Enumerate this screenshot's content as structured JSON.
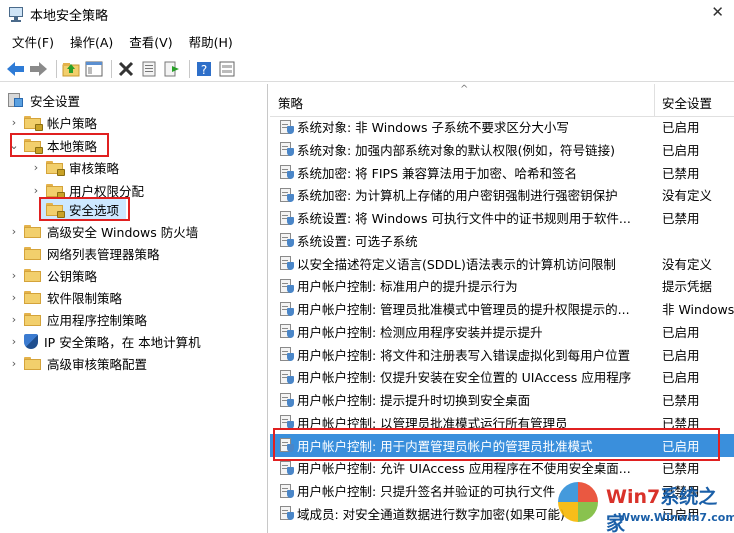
{
  "window": {
    "title": "本地安全策略",
    "close_glyph": "✕"
  },
  "menu": [
    "文件(F)",
    "操作(A)",
    "查看(V)",
    "帮助(H)"
  ],
  "toolbar_icons": [
    "back-arrow-icon",
    "forward-arrow-icon",
    "up-folder-icon",
    "show-hide-tree-icon",
    "delete-icon",
    "properties-icon",
    "export-list-icon",
    "help-icon",
    "console-view-icon"
  ],
  "tree": {
    "root": "安全设置",
    "items": [
      {
        "label": "帐户策略",
        "level": 1,
        "expander": "›"
      },
      {
        "label": "本地策略",
        "level": 1,
        "expander": "⌄"
      },
      {
        "label": "审核策略",
        "level": 2,
        "expander": "›"
      },
      {
        "label": "用户权限分配",
        "level": 2,
        "expander": "›"
      },
      {
        "label": "安全选项",
        "level": 2,
        "expander": ""
      },
      {
        "label": "高级安全 Windows 防火墙",
        "level": 1,
        "expander": "›"
      },
      {
        "label": "网络列表管理器策略",
        "level": 1,
        "expander": ""
      },
      {
        "label": "公钥策略",
        "level": 1,
        "expander": "›"
      },
      {
        "label": "软件限制策略",
        "level": 1,
        "expander": "›"
      },
      {
        "label": "应用程序控制策略",
        "level": 1,
        "expander": "›"
      },
      {
        "label": "IP 安全策略，在 本地计算机",
        "level": 1,
        "expander": "›"
      },
      {
        "label": "高级审核策略配置",
        "level": 1,
        "expander": "›"
      }
    ]
  },
  "list": {
    "columns": {
      "policy": "策略",
      "setting": "安全设置",
      "sort_glyph": "^"
    },
    "rows": [
      {
        "policy": "系统对象: 非 Windows 子系统不要求区分大小写",
        "setting": "已启用"
      },
      {
        "policy": "系统对象: 加强内部系统对象的默认权限(例如，符号链接)",
        "setting": "已启用"
      },
      {
        "policy": "系统加密: 将 FIPS 兼容算法用于加密、哈希和签名",
        "setting": "已禁用"
      },
      {
        "policy": "系统加密: 为计算机上存储的用户密钥强制进行强密钥保护",
        "setting": "没有定义"
      },
      {
        "policy": "系统设置: 将 Windows 可执行文件中的证书规则用于软件...",
        "setting": "已禁用"
      },
      {
        "policy": "系统设置: 可选子系统",
        "setting": ""
      },
      {
        "policy": "以安全描述符定义语言(SDDL)语法表示的计算机访问限制",
        "setting": "没有定义"
      },
      {
        "policy": "用户帐户控制: 标准用户的提升提示行为",
        "setting": "提示凭据"
      },
      {
        "policy": "用户帐户控制: 管理员批准模式中管理员的提升权限提示的...",
        "setting": "非 Windows"
      },
      {
        "policy": "用户帐户控制: 检测应用程序安装并提示提升",
        "setting": "已启用"
      },
      {
        "policy": "用户帐户控制: 将文件和注册表写入错误虚拟化到每用户位置",
        "setting": "已启用"
      },
      {
        "policy": "用户帐户控制: 仅提升安装在安全位置的 UIAccess 应用程序",
        "setting": "已启用"
      },
      {
        "policy": "用户帐户控制: 提示提升时切换到安全桌面",
        "setting": "已禁用"
      },
      {
        "policy": "用户帐户控制: 以管理员批准模式运行所有管理员",
        "setting": "已禁用"
      },
      {
        "policy": "用户帐户控制: 用于内置管理员帐户的管理员批准模式",
        "setting": "已启用",
        "selected": true
      },
      {
        "policy": "用户帐户控制: 允许 UIAccess 应用程序在不使用安全桌面...",
        "setting": "已禁用"
      },
      {
        "policy": "用户帐户控制: 只提升签名并验证的可执行文件",
        "setting": "已禁用"
      },
      {
        "policy": "域成员: 对安全通道数据进行数字加密(如果可能)",
        "setting": "已启用"
      }
    ]
  },
  "watermark": {
    "brand_a": "Win7",
    "brand_b": "系统之家",
    "url": "Www.Winwin7.com"
  }
}
